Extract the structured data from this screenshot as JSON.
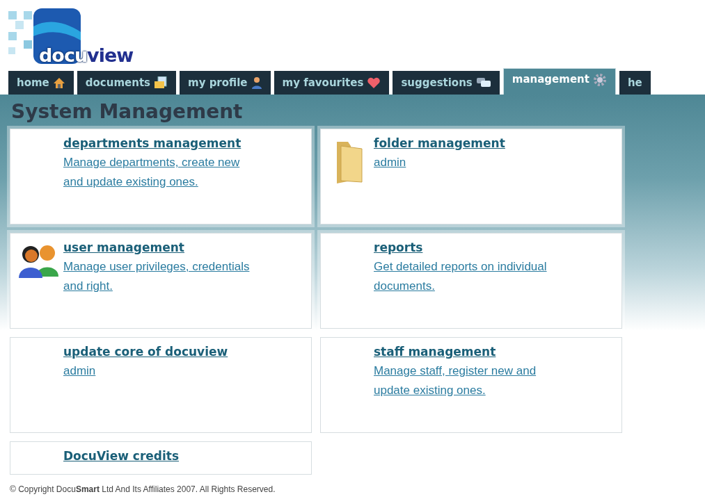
{
  "logo": {
    "part_1": "docu",
    "part_2": "view"
  },
  "tabs": [
    {
      "label": "home",
      "selected": false
    },
    {
      "label": "documents",
      "selected": false
    },
    {
      "label": "my profile",
      "selected": false
    },
    {
      "label": "my favourites",
      "selected": false
    },
    {
      "label": "suggestions",
      "selected": false
    },
    {
      "label": "management",
      "selected": true
    },
    {
      "label": "he",
      "selected": false
    }
  ],
  "heading": "System Management",
  "cards": [
    {
      "title": "departments management",
      "description": "Manage departments, create new and update existing ones."
    },
    {
      "title": "folder management",
      "description": "admin"
    },
    {
      "title": "user management",
      "description": "Manage user privileges, credentials and right."
    },
    {
      "title": "reports",
      "description": "Get detailed reports on individual documents."
    },
    {
      "title": "update core of docuview",
      "description": "admin"
    },
    {
      "title": "staff management",
      "description": "Manage staff, register new and update existing ones."
    },
    {
      "title": "DocuView credits"
    }
  ],
  "footer": "© Copyright Docu**Smart** Ltd And Its Affiliates 2007. All Rights Reserved."
}
